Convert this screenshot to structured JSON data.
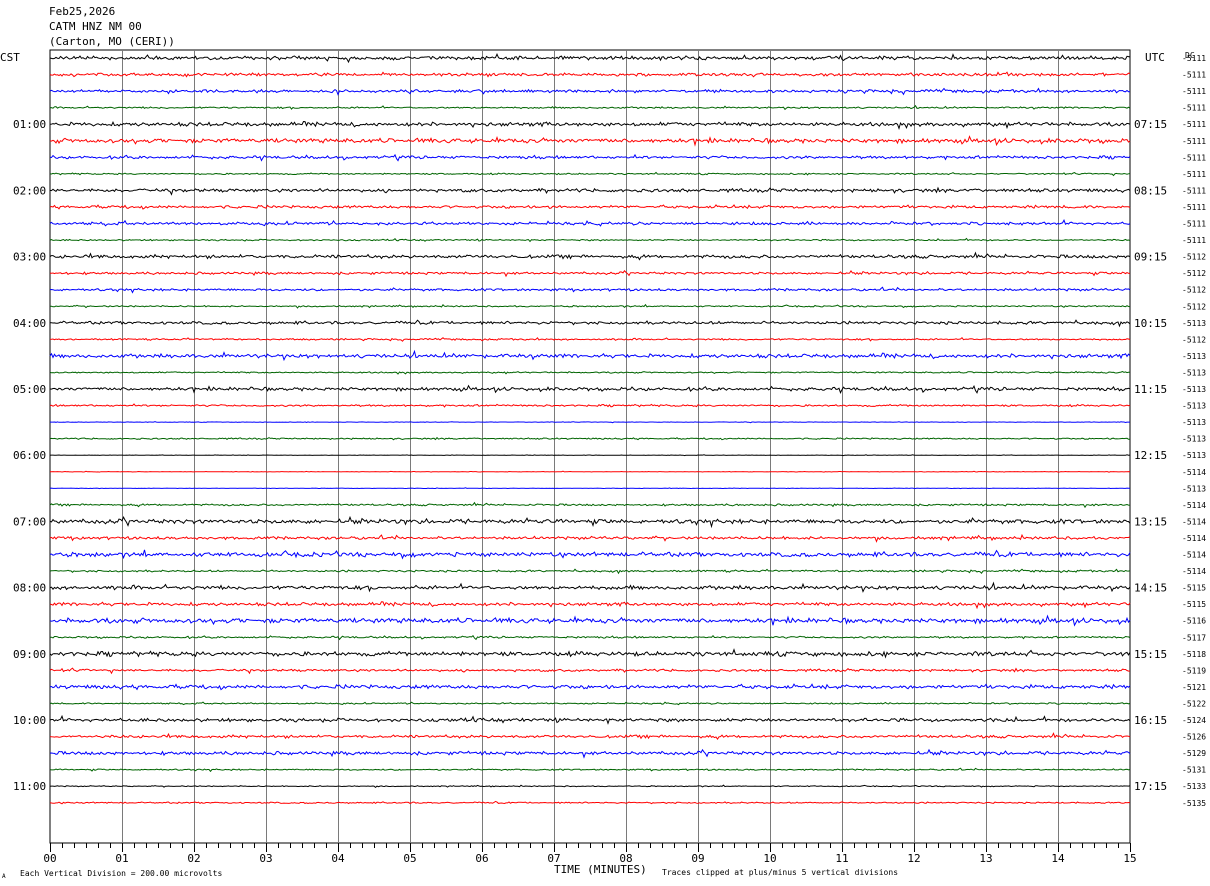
{
  "header": {
    "date": "Feb25,2026",
    "station": "CATM HNZ NM 00",
    "location": "(Carton, MO (CERI))"
  },
  "labels": {
    "left_tz": "CST",
    "right_tz": "UTC",
    "dc": "DC",
    "time_axis": "TIME (MINUTES)",
    "scale_note": "Each Vertical Division =  200.00 microvolts",
    "clip_note": "Traces clipped at plus/minus 5 vertical divisions",
    "corner_mark": "A"
  },
  "chart_data": {
    "type": "line",
    "description_kind": "helicorder",
    "x_ticks": [
      "00",
      "01",
      "02",
      "03",
      "04",
      "05",
      "06",
      "07",
      "08",
      "09",
      "10",
      "11",
      "12",
      "13",
      "14",
      "15"
    ],
    "xlim": [
      0,
      15
    ],
    "rows_per_hour": 4,
    "trace_colors": [
      "#000000",
      "#ff0000",
      "#0000ff",
      "#006400"
    ],
    "left_hour_labels": [
      "01:00",
      "02:00",
      "03:00",
      "04:00",
      "05:00",
      "06:00",
      "07:00",
      "08:00",
      "09:00",
      "10:00",
      "11:00"
    ],
    "right_hour_labels": [
      "07:15",
      "08:15",
      "09:15",
      "10:15",
      "11:15",
      "12:15",
      "13:15",
      "14:15",
      "15:15",
      "16:15",
      "17:15"
    ],
    "dc_offsets": [
      "-5111",
      "-5111",
      "-5111",
      "-5111",
      "-5111",
      "-5111",
      "-5111",
      "-5111",
      "-5111",
      "-5111",
      "-5111",
      "-5111",
      "-5112",
      "-5112",
      "-5112",
      "-5112",
      "-5113",
      "-5112",
      "-5113",
      "-5113",
      "-5113",
      "-5113",
      "-5113",
      "-5113",
      "-5113",
      "-5114",
      "-5113",
      "-5114",
      "-5114",
      "-5114",
      "-5114",
      "-5114",
      "-5115",
      "-5115",
      "-5116",
      "-5117",
      "-5118",
      "-5119",
      "-5121",
      "-5122",
      "-5124",
      "-5126",
      "-5129",
      "-5131",
      "-5133",
      "-5135"
    ],
    "row_noise": [
      1.5,
      1.2,
      1.2,
      0.7,
      1.6,
      1.8,
      1.2,
      0.6,
      1.4,
      1.2,
      1.2,
      0.6,
      1.4,
      1.0,
      1.0,
      0.6,
      1.2,
      0.7,
      1.6,
      0.6,
      1.4,
      0.8,
      0.2,
      0.6,
      0.2,
      0.2,
      0.2,
      0.8,
      1.8,
      1.2,
      1.8,
      0.8,
      1.6,
      1.4,
      2.0,
      0.8,
      1.8,
      1.0,
      1.6,
      0.6,
      1.4,
      1.2,
      1.4,
      0.6,
      0.4,
      0.6
    ]
  }
}
